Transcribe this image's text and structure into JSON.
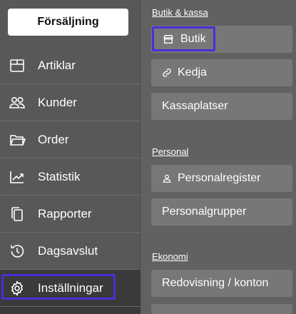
{
  "sidebar": {
    "primary_button": "Försäljning",
    "items": [
      {
        "label": "Artiklar",
        "icon": "box-icon"
      },
      {
        "label": "Kunder",
        "icon": "users-icon"
      },
      {
        "label": "Order",
        "icon": "folder-icon"
      },
      {
        "label": "Statistik",
        "icon": "trending-up-icon"
      },
      {
        "label": "Rapporter",
        "icon": "copy-icon"
      },
      {
        "label": "Dagsavslut",
        "icon": "history-icon"
      },
      {
        "label": "Inställningar",
        "icon": "gear-icon",
        "active": true
      }
    ]
  },
  "panel": {
    "sections": [
      {
        "title": "Butik & kassa",
        "items": [
          {
            "label": "Butik",
            "icon": "store-icon",
            "focused": true
          },
          {
            "label": "Kedja",
            "icon": "link-icon"
          },
          {
            "label": "Kassaplatser"
          }
        ]
      },
      {
        "title": "Personal",
        "items": [
          {
            "label": "Personalregister",
            "icon": "user-icon"
          },
          {
            "label": "Personalgrupper"
          }
        ]
      },
      {
        "title": "Ekonomi",
        "items": [
          {
            "label": "Redovisning / konton"
          }
        ]
      }
    ]
  },
  "colors": {
    "focus_outline": "#4a2fd8",
    "sidebar_bg": "#585858",
    "panel_bg": "#616161",
    "card_bg": "#777777"
  }
}
